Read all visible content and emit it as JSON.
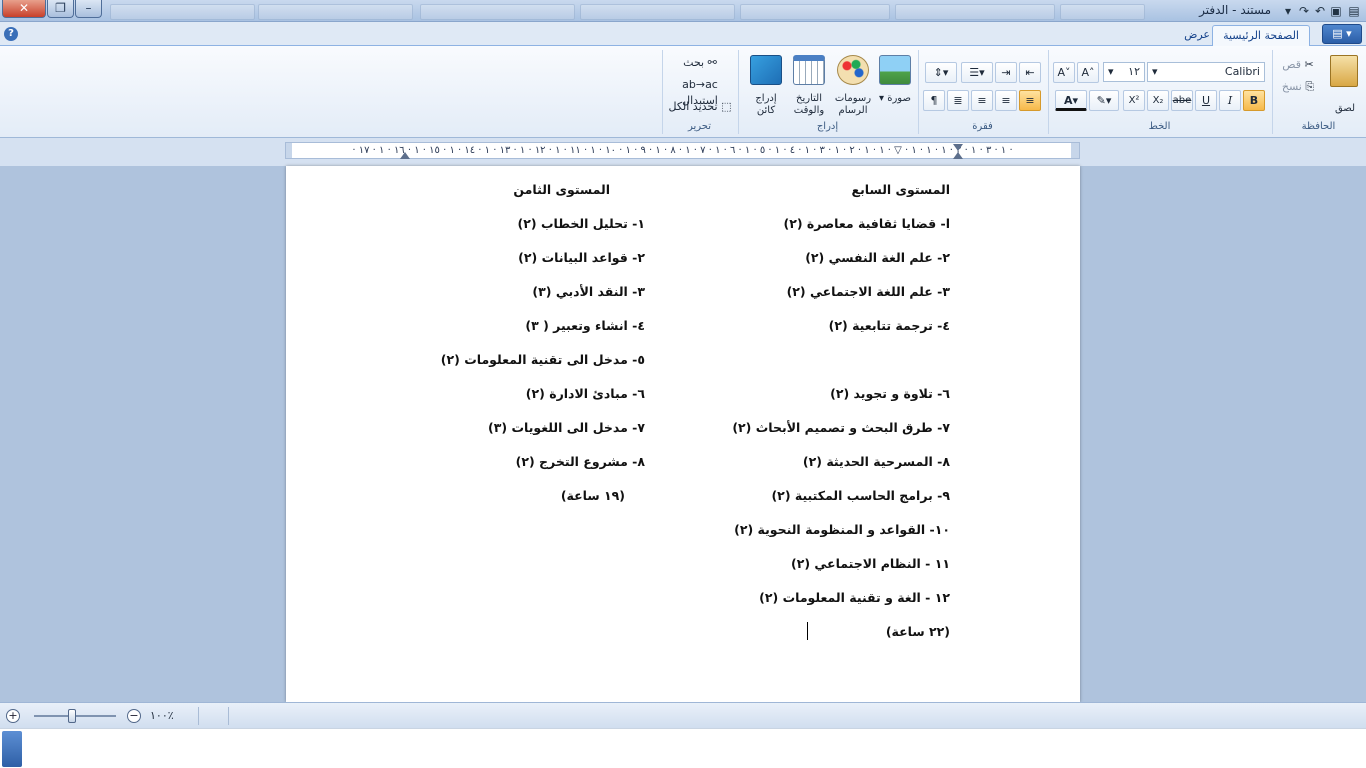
{
  "window": {
    "title": "مستند - الدفتر",
    "close_glyph": "✕",
    "restore_glyph": "❐",
    "minimize_glyph": "–"
  },
  "tabs": {
    "app_menu_glyph": "▤ ▾",
    "home": "الصفحة الرئيسية",
    "view": "عرض",
    "help_glyph": "?"
  },
  "ribbon": {
    "clipboard": {
      "label": "الحافظة",
      "paste": "لصق",
      "cut": "قص",
      "copy": "نسخ"
    },
    "font": {
      "label": "الخط",
      "family": "Calibri",
      "size": "١٢",
      "bold": "B",
      "italic": "I",
      "underline": "U",
      "strike": "abe",
      "subscript": "X₂",
      "superscript": "X²",
      "color_glyph": "A"
    },
    "paragraph": {
      "label": "فقرة"
    },
    "insert": {
      "label": "إدراج",
      "picture": "صورة",
      "paint": "رسومات الرسام",
      "datetime": "التاريخ والوقت",
      "object": "إدراج كائن"
    },
    "editing": {
      "label": "تحرير",
      "find": "بحث",
      "replace": "استبدال",
      "select_all": "تحديد الكل"
    }
  },
  "ruler": {
    "scale": "· ١ · ٣ · ١ · ٢ · ١ · ١ · ١ · ▽ · ١ · ١ · ٢ · ١ · ٣ · ١ · ٤ · ١ · ٥ · ١ · ٦ · ١ · ٧ · ١ · ٨ · ١ · ٩ · ١ · ١٠ · ١ · ١١ · ١ · ١٢ · ١ · ١٣ · ١ · ١٤ · ١ · ١٥ · ١ · ١٦ · ١ · ١٧ ·"
  },
  "document": {
    "right_column": {
      "heading": "المستوى السابع",
      "lines": [
        "ا- قضايا ثقافية معاصرة (٢)",
        "٢- علم الغة النفسي (٢)",
        "٣- علم اللغة الاجتماعي (٢)",
        "٤- ترجمة تتابعية (٢)",
        "",
        "٦- تلاوة و تجويد (٢)",
        "٧- طرق البحث و تصميم الأبحاث (٢)",
        "٨- المسرحية الحديثة (٢)",
        "٩- برامج الحاسب المكتبية (٢)",
        "١٠- القواعد و المنظومة النحوية (٢)",
        "١١ - النظام الاجتماعي (٢)",
        "١٢ - الغة و تقنية المعلومات (٢)",
        "(٢٢ ساعة)"
      ]
    },
    "left_column": {
      "heading": "المستوى الثامن",
      "lines": [
        "١- تحليل الخطاب (٢)",
        "٢- قواعد البيانات (٢)",
        "٣- النقد الأدبي (٣)",
        "٤- انشاء وتعبير ( ٣)",
        "٥- مدخل الى تقنية المعلومات (٢)",
        "٦- مبادئ الادارة (٢)",
        "٧- مدخل الى اللغويات (٣)",
        "٨- مشروع التخرج (٢)",
        "(١٩ ساعة)"
      ]
    }
  },
  "status": {
    "zoom_in": "+",
    "zoom_out": "−",
    "zoom_level": "١٠٠٪"
  },
  "colors": {
    "ribbon_active": "#f6b94a",
    "doc_background": "#afc3dd",
    "accent": "#2b5ea8"
  }
}
